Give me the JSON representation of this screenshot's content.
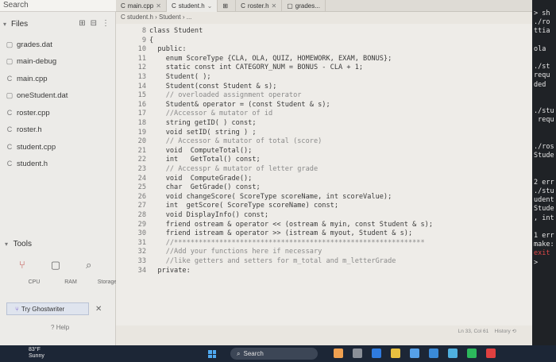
{
  "sidebar": {
    "search_label": "Search",
    "files_label": "Files",
    "files": [
      {
        "name": "grades.dat",
        "icon": "file-icon"
      },
      {
        "name": "main-debug",
        "icon": "file-icon"
      },
      {
        "name": "main.cpp",
        "icon": "cpp-file-icon"
      },
      {
        "name": "oneStudent.dat",
        "icon": "file-icon"
      },
      {
        "name": "roster.cpp",
        "icon": "cpp-file-icon"
      },
      {
        "name": "roster.h",
        "icon": "c-header-icon"
      },
      {
        "name": "student.cpp",
        "icon": "cpp-file-icon"
      },
      {
        "name": "student.h",
        "icon": "c-header-icon"
      }
    ],
    "tools_label": "Tools",
    "tools": [
      "CPU",
      "RAM",
      "Storage"
    ],
    "ghost_label": "Try Ghostwriter",
    "help_label": "Help"
  },
  "tabs": [
    {
      "label": "main.cpp"
    },
    {
      "label": "student.h"
    },
    {
      "label": ""
    },
    {
      "label": "roster.h"
    },
    {
      "label": "grades..."
    }
  ],
  "breadcrumb": "student.h › Student › ...",
  "code": [
    {
      "ln": "8",
      "text": "class Student"
    },
    {
      "ln": "9",
      "text": "{"
    },
    {
      "ln": "10",
      "text": "  public:"
    },
    {
      "ln": "11",
      "text": "    enum ScoreType {CLA, OLA, QUIZ, HOMEWORK, EXAM, BONUS};"
    },
    {
      "ln": "12",
      "text": "    static const int CATEGORY_NUM = BONUS - CLA + 1;"
    },
    {
      "ln": "13",
      "text": "    Student( );"
    },
    {
      "ln": "14",
      "text": "    Student(const Student & s);"
    },
    {
      "ln": "15",
      "text": "    // overloaded assignment operator"
    },
    {
      "ln": "16",
      "text": "    Student& operator = (const Student & s);"
    },
    {
      "ln": "17",
      "text": "    //Accessor & mutator of id"
    },
    {
      "ln": "18",
      "text": "    string getID( ) const;"
    },
    {
      "ln": "19",
      "text": "    void setID( string ) ;"
    },
    {
      "ln": "20",
      "text": "    // Accessor & mutator of total (score)"
    },
    {
      "ln": "21",
      "text": "    void  ComputeTotal();"
    },
    {
      "ln": "22",
      "text": "    int   GetTotal() const;"
    },
    {
      "ln": "23",
      "text": "    // Accesspr & mutator of letter grade"
    },
    {
      "ln": "24",
      "text": "    void  ComputeGrade();"
    },
    {
      "ln": "25",
      "text": "    char  GetGrade() const;"
    },
    {
      "ln": "26",
      "text": "    void changeScore( ScoreType scoreName, int scoreValue);"
    },
    {
      "ln": "27",
      "text": "    int  getScore( ScoreType scoreName) const;"
    },
    {
      "ln": "28",
      "text": "    void DisplayInfo() const;"
    },
    {
      "ln": "29",
      "text": "    friend ostream & operator << (ostream & myin, const Student & s);"
    },
    {
      "ln": "30",
      "text": "    friend istream & operator >> (istream & myout, Student & s);"
    },
    {
      "ln": "31",
      "text": "    //*************************************************************"
    },
    {
      "ln": "32",
      "text": "    //Add your functions here if necessary"
    },
    {
      "ln": "33",
      "text": "    //like getters and setters for m_total and m_letterGrade"
    },
    {
      "ln": "34",
      "text": "  private:"
    }
  ],
  "status": {
    "position": "Ln 33, Col 61",
    "history": "History"
  },
  "terminal": [
    {
      "text": "> sh",
      "red": false
    },
    {
      "text": "./ro",
      "red": false
    },
    {
      "text": "ttia",
      "red": false
    },
    {
      "text": "",
      "red": false
    },
    {
      "text": "ola",
      "red": false
    },
    {
      "text": "",
      "red": false
    },
    {
      "text": "./st",
      "red": false
    },
    {
      "text": "requ",
      "red": false
    },
    {
      "text": "ded",
      "red": false
    },
    {
      "text": "",
      "red": false
    },
    {
      "text": "",
      "red": false
    },
    {
      "text": "./stu",
      "red": false
    },
    {
      "text": " requ",
      "red": false
    },
    {
      "text": "",
      "red": false
    },
    {
      "text": "",
      "red": false
    },
    {
      "text": "./ros",
      "red": false
    },
    {
      "text": "Stude",
      "red": false
    },
    {
      "text": "",
      "red": false
    },
    {
      "text": "",
      "red": false
    },
    {
      "text": "2 err",
      "red": false
    },
    {
      "text": "./stu",
      "red": false
    },
    {
      "text": "udent",
      "red": false
    },
    {
      "text": "Stude",
      "red": false
    },
    {
      "text": ", int",
      "red": false
    },
    {
      "text": "",
      "red": false
    },
    {
      "text": "1 err",
      "red": false
    },
    {
      "text": "make:",
      "red": false
    },
    {
      "text": "exit",
      "red": true
    },
    {
      "text": "> ",
      "red": false
    }
  ],
  "taskbar": {
    "temp": "83°F",
    "weather": "Sunny",
    "search_label": "Search"
  }
}
